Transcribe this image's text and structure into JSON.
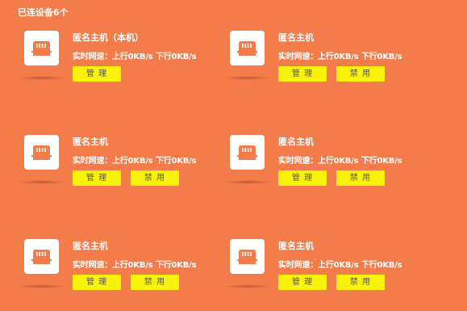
{
  "header": {
    "connected_text": "已连设备6个"
  },
  "labels": {
    "realtime_speed": "实时网速：",
    "upload": "上行0KB/s",
    "download": "下行0KB/s",
    "manage": "管 理",
    "disable": "禁 用"
  },
  "devices": [
    {
      "name": "匿名主机（本机）",
      "icon": "router-port-icon"
    },
    {
      "name": "匿名主机",
      "icon": "router-port-icon"
    },
    {
      "name": "匿名主机",
      "icon": "router-port-icon"
    },
    {
      "name": "匿名主机",
      "icon": "router-port-icon"
    },
    {
      "name": "匿名主机",
      "icon": "router-port-icon"
    },
    {
      "name": "匿名主机",
      "icon": "router-port-icon"
    }
  ],
  "colors": {
    "background": "#f47c4b",
    "button": "#f9f209",
    "icon": "#f47c4b"
  }
}
